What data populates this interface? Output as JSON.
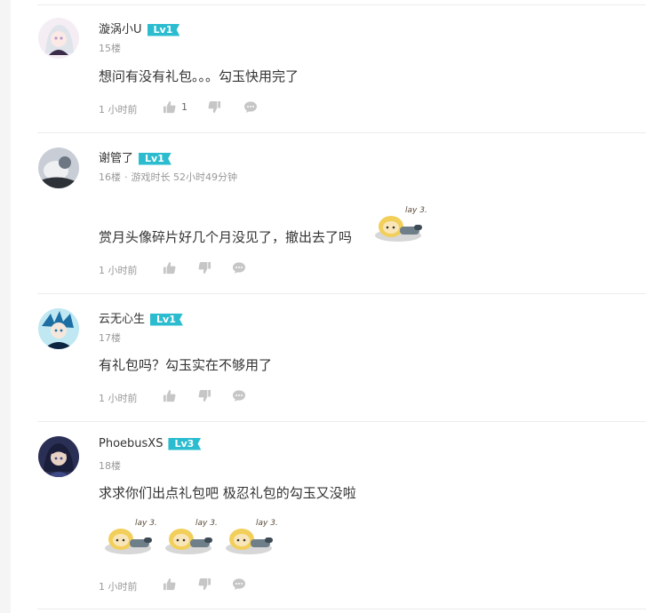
{
  "comments": [
    {
      "username": "漩涡小U",
      "level": "Lv1",
      "floor": "15楼",
      "playtime_label": "",
      "playtime": "",
      "text": "想问有没有礼包。。。勾玉快用完了",
      "time": "1 小时前",
      "likes": "1",
      "avatar_colors": [
        "#dfe3ea",
        "#b79ac9",
        "#3b2d49"
      ]
    },
    {
      "username": "谢管了",
      "level": "Lv1",
      "floor": "16楼",
      "playtime_label": "游戏时长",
      "playtime": "52小时49分钟",
      "text": "赏月头像碎片好几个月没见了，撤出去了吗",
      "time": "1 小时前",
      "likes": "",
      "avatar_colors": [
        "#c9ced6",
        "#6d7683",
        "#2d3138"
      ]
    },
    {
      "username": "云无心生",
      "level": "Lv1",
      "floor": "17楼",
      "playtime_label": "",
      "playtime": "",
      "text": "有礼包吗？勾玉实在不够用了",
      "time": "1 小时前",
      "likes": "",
      "avatar_colors": [
        "#9ee0f0",
        "#1d6fa3",
        "#0c2440"
      ]
    },
    {
      "username": "PhoebusXS",
      "level": "Lv3",
      "floor": "18楼",
      "playtime_label": "",
      "playtime": "",
      "text": "求求你们出点礼包吧 极忍礼包的勾玉又没啦",
      "time": "1 小时前",
      "likes": "",
      "avatar_colors": [
        "#e8d2c4",
        "#3f4a86",
        "#1b1e3a"
      ]
    }
  ],
  "icons": {
    "like": "thumbs-up-icon",
    "dislike": "thumbs-down-icon",
    "reply": "speech-bubble-icon"
  },
  "colors": {
    "level_badge": "#2bbccf",
    "meta_text": "#999999"
  }
}
